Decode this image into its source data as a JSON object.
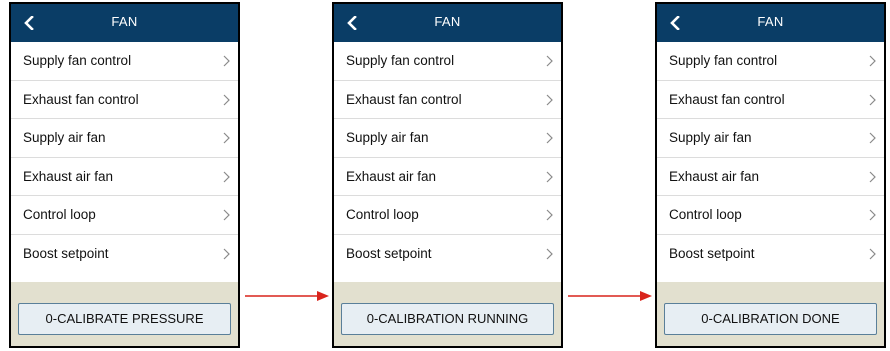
{
  "panels": [
    {
      "header": {
        "title": "FAN",
        "back_icon": "chevron-left-icon"
      },
      "menu": [
        {
          "label": "Supply fan control"
        },
        {
          "label": "Exhaust fan control"
        },
        {
          "label": "Supply air fan"
        },
        {
          "label": "Exhaust air fan"
        },
        {
          "label": "Control loop"
        },
        {
          "label": "Boost setpoint"
        }
      ],
      "button_label": "0-CALIBRATE PRESSURE"
    },
    {
      "header": {
        "title": "FAN",
        "back_icon": "chevron-left-icon"
      },
      "menu": [
        {
          "label": "Supply fan control"
        },
        {
          "label": "Exhaust fan control"
        },
        {
          "label": "Supply air fan"
        },
        {
          "label": "Exhaust air fan"
        },
        {
          "label": "Control loop"
        },
        {
          "label": "Boost setpoint"
        }
      ],
      "button_label": "0-CALIBRATION RUNNING"
    },
    {
      "header": {
        "title": "FAN",
        "back_icon": "chevron-left-icon"
      },
      "menu": [
        {
          "label": "Supply fan control"
        },
        {
          "label": "Exhaust fan control"
        },
        {
          "label": "Supply air fan"
        },
        {
          "label": "Exhaust air fan"
        },
        {
          "label": "Control loop"
        },
        {
          "label": "Boost setpoint"
        }
      ],
      "button_label": "0-CALIBRATION DONE"
    }
  ],
  "colors": {
    "header_bg": "#0a3d66",
    "footer_bg": "#e2e0cf",
    "button_bg": "#e7eef3",
    "arrow": "#d9241c"
  }
}
